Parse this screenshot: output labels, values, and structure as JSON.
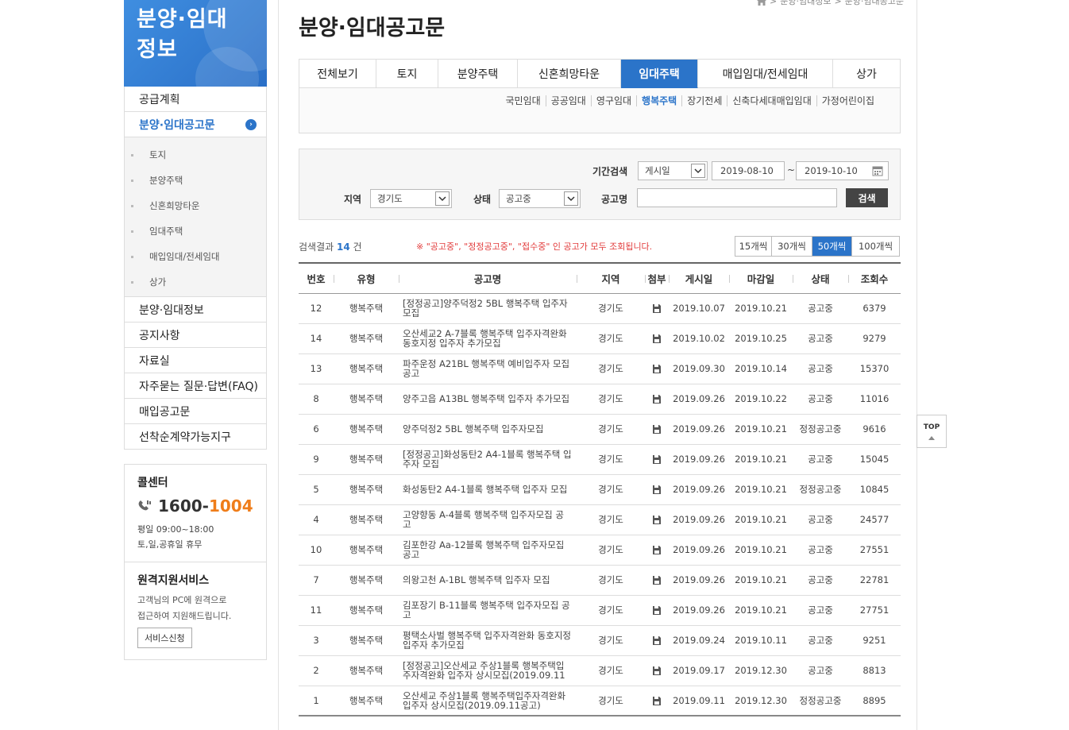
{
  "sidebar": {
    "hero_title": "분양·임대\n정보",
    "menu_top": [
      {
        "label": "공급계획"
      }
    ],
    "active_menu": {
      "label": "분양·임대공고문",
      "arrow": "›"
    },
    "submenu": [
      {
        "label": "토지"
      },
      {
        "label": "분양주택"
      },
      {
        "label": "신혼희망타운"
      },
      {
        "label": "임대주택"
      },
      {
        "label": "매입임대/전세임대"
      },
      {
        "label": "상가"
      }
    ],
    "menu_bottom": [
      {
        "label": "분양·임대정보"
      },
      {
        "label": "공지사항"
      },
      {
        "label": "자료실"
      },
      {
        "label": "자주묻는 질문·답변(FAQ)"
      },
      {
        "label": "매입공고문"
      },
      {
        "label": "선착순계약가능지구"
      }
    ],
    "call_center": {
      "title": "콜센터",
      "number_prefix": "1600-",
      "number_suffix": "1004",
      "hours_weekday": "평일 09:00~18:00",
      "hours_holiday": "토,일,공휴일 휴무"
    },
    "remote": {
      "title": "원격지원서비스",
      "desc": "고객님의 PC에 원격으로\n접근하여 지원해드립니다.",
      "button": "서비스신청"
    }
  },
  "breadcrumb": {
    "sep": ">",
    "items": [
      "분양·임대정보",
      "분양·임대공고문"
    ]
  },
  "page_title": "분양·임대공고문",
  "tabs": [
    {
      "label": "전체보기",
      "width": 97
    },
    {
      "label": "토지",
      "width": 78
    },
    {
      "label": "분양주택",
      "width": 100
    },
    {
      "label": "신혼희망타운",
      "width": 130
    },
    {
      "label": "임대주택",
      "width": 97,
      "active": true
    },
    {
      "label": "매입임대/전세임대",
      "width": 170
    },
    {
      "label": "상가",
      "width": 84
    }
  ],
  "subtabs": [
    {
      "label": "국민임대"
    },
    {
      "label": "공공임대"
    },
    {
      "label": "영구임대"
    },
    {
      "label": "행복주택",
      "active": true
    },
    {
      "label": "장기전세"
    },
    {
      "label": "신축다세대매입임대"
    },
    {
      "label": "가정어린이집"
    }
  ],
  "search": {
    "period_label": "기간검색",
    "period_value": "게시일",
    "date_from": "2019-08-10",
    "date_sep": "~",
    "date_to": "2019-10-10",
    "region_label": "지역",
    "region_value": "경기도",
    "status_label": "상태",
    "status_value": "공고중",
    "name_label": "공고명",
    "name_value": "",
    "search_button": "검색"
  },
  "result": {
    "prefix": "검색결과",
    "count": "14",
    "suffix": "건",
    "notice": "※ \"공고중\", \"정정공고중\", \"접수중\" 인 공고가 모두 조회됩니다."
  },
  "page_sizes": [
    {
      "label": "15개씩"
    },
    {
      "label": "30개씩"
    },
    {
      "label": "50개씩",
      "active": true
    },
    {
      "label": "100개씩"
    }
  ],
  "table": {
    "headers": [
      "번호",
      "유형",
      "공고명",
      "지역",
      "첨부",
      "게시일",
      "마감일",
      "상태",
      "조회수"
    ],
    "rows": [
      {
        "no": "12",
        "type": "행복주택",
        "title": "[정정공고]양주덕정2 5BL 행복주택 입주자모집",
        "region": "경기도",
        "posted": "2019.10.07",
        "deadline": "2019.10.21",
        "status": "공고중",
        "views": "6379"
      },
      {
        "no": "14",
        "type": "행복주택",
        "title": "오산세교2 A-7블록 행복주택 입주자격완화 동호지정 입주자 추가모집",
        "region": "경기도",
        "posted": "2019.10.02",
        "deadline": "2019.10.25",
        "status": "공고중",
        "views": "9279"
      },
      {
        "no": "13",
        "type": "행복주택",
        "title": "파주운정 A21BL 행복주택 예비입주자 모집 공고",
        "region": "경기도",
        "posted": "2019.09.30",
        "deadline": "2019.10.14",
        "status": "공고중",
        "views": "15370"
      },
      {
        "no": "8",
        "type": "행복주택",
        "title": "양주고읍 A13BL 행복주택 입주자 추가모집",
        "region": "경기도",
        "posted": "2019.09.26",
        "deadline": "2019.10.22",
        "status": "공고중",
        "views": "11016"
      },
      {
        "no": "6",
        "type": "행복주택",
        "title": "양주덕정2 5BL 행복주택 입주자모집",
        "region": "경기도",
        "posted": "2019.09.26",
        "deadline": "2019.10.21",
        "status": "정정공고중",
        "views": "9616"
      },
      {
        "no": "9",
        "type": "행복주택",
        "title": "[정정공고]화성동탄2 A4-1블록 행복주택 입주자 모집",
        "region": "경기도",
        "posted": "2019.09.26",
        "deadline": "2019.10.21",
        "status": "공고중",
        "views": "15045"
      },
      {
        "no": "5",
        "type": "행복주택",
        "title": "화성동탄2 A4-1블록 행복주택 입주자 모집",
        "region": "경기도",
        "posted": "2019.09.26",
        "deadline": "2019.10.21",
        "status": "정정공고중",
        "views": "10845"
      },
      {
        "no": "4",
        "type": "행복주택",
        "title": "고양향동 A-4블록 행복주택 입주자모집 공고",
        "region": "경기도",
        "posted": "2019.09.26",
        "deadline": "2019.10.21",
        "status": "공고중",
        "views": "24577"
      },
      {
        "no": "10",
        "type": "행복주택",
        "title": "김포한강 Aa-12블록 행복주택 입주자모집 공고",
        "region": "경기도",
        "posted": "2019.09.26",
        "deadline": "2019.10.21",
        "status": "공고중",
        "views": "27551"
      },
      {
        "no": "7",
        "type": "행복주택",
        "title": "의왕고천 A-1BL 행복주택 입주자 모집",
        "region": "경기도",
        "posted": "2019.09.26",
        "deadline": "2019.10.21",
        "status": "공고중",
        "views": "22781"
      },
      {
        "no": "11",
        "type": "행복주택",
        "title": "김포장기 B-11블록 행복주택 입주자모집 공고",
        "region": "경기도",
        "posted": "2019.09.26",
        "deadline": "2019.10.21",
        "status": "공고중",
        "views": "27751"
      },
      {
        "no": "3",
        "type": "행복주택",
        "title": "평택소사벌 행복주택 입주자격완화 동호지정 입주자 추가모집",
        "region": "경기도",
        "posted": "2019.09.24",
        "deadline": "2019.10.11",
        "status": "공고중",
        "views": "9251"
      },
      {
        "no": "2",
        "type": "행복주택",
        "title": "[정정공고]오산세교 주상1블록 행복주택입주자격완화 입주자 상시모집(2019.09.11",
        "region": "경기도",
        "posted": "2019.09.17",
        "deadline": "2019.12.30",
        "status": "공고중",
        "views": "8813"
      },
      {
        "no": "1",
        "type": "행복주택",
        "title": "오산세교 주상1블록 행복주택입주자격완화 입주자 상시모집(2019.09.11공고)",
        "region": "경기도",
        "posted": "2019.09.11",
        "deadline": "2019.12.30",
        "status": "정정공고중",
        "views": "8895"
      }
    ]
  },
  "top_button": "TOP",
  "colors": {
    "accent": "#2b74c9",
    "orange": "#ef7d1a",
    "notice_red": "#e23b3b"
  }
}
